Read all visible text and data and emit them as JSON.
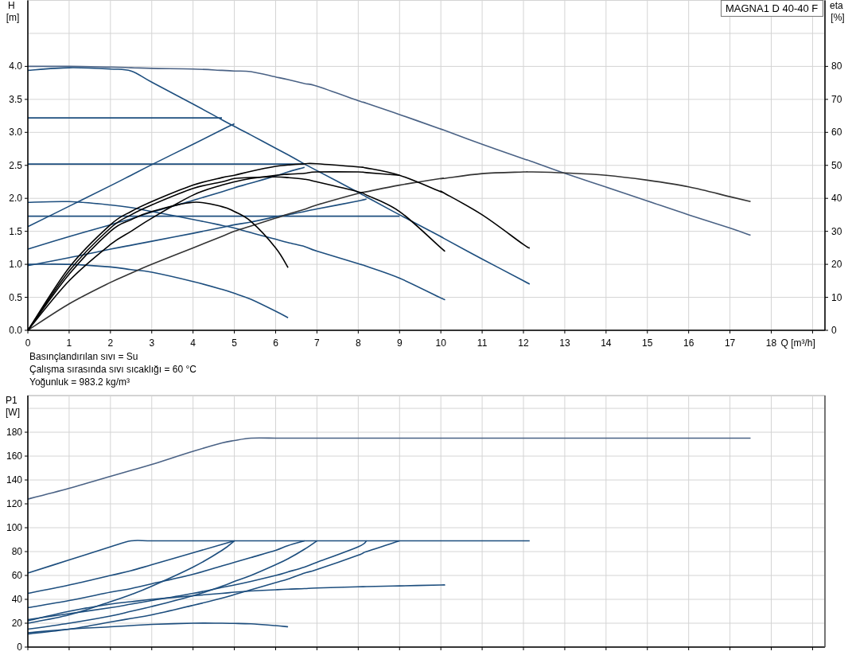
{
  "head_chart": {
    "chart_data": {
      "type": "line",
      "grid": true,
      "title": "MAGNA1 D 40-40 F",
      "xlabel": "Q [m³/h]",
      "ylabel": "H [m]",
      "y2label": "eta [%]",
      "x": [
        0,
        1,
        2,
        2.5,
        3,
        4,
        4.7,
        5,
        5.4,
        6,
        6.3,
        6.7,
        7,
        8,
        8.2,
        9,
        10,
        10.05,
        11,
        12,
        12.15,
        13,
        14,
        15,
        16,
        17,
        17.5
      ],
      "xlim": [
        0,
        19.3
      ],
      "ylim": [
        0,
        5
      ],
      "y2lim": [
        0,
        100
      ],
      "xticks": [
        0,
        1,
        2,
        3,
        4,
        5,
        6,
        7,
        8,
        9,
        10,
        11,
        12,
        13,
        14,
        15,
        16,
        17,
        18
      ],
      "yticks": [
        {
          "value": 0,
          "label": "0.0"
        },
        {
          "value": 0.5,
          "label": "0.5"
        },
        {
          "value": 1,
          "label": "1.0"
        },
        {
          "value": 1.5,
          "label": "1.5"
        },
        {
          "value": 2,
          "label": "2.0"
        },
        {
          "value": 2.5,
          "label": "2.5"
        },
        {
          "value": 3,
          "label": "3.0"
        },
        {
          "value": 3.5,
          "label": "3.5"
        },
        {
          "value": 4,
          "label": "4.0"
        }
      ],
      "y2ticks": [
        0,
        10,
        20,
        30,
        40,
        50,
        60,
        70,
        80
      ],
      "series": [
        {
          "color": "#4a6285",
          "values": [
            4.0,
            4.0,
            3.99,
            3.98,
            3.97,
            3.96,
            3.94,
            3.93,
            3.92,
            3.84,
            3.8,
            3.74,
            3.7,
            3.48,
            3.44,
            3.27,
            3.05,
            3.04,
            2.82,
            2.6,
            2.57,
            2.38,
            2.17,
            1.96,
            1.75,
            1.55,
            1.44
          ]
        },
        {
          "color": "#1d4e7e",
          "values": [
            3.94,
            3.98,
            3.96,
            3.93,
            3.76,
            3.43,
            3.19,
            3.09,
            2.96,
            2.76,
            2.66,
            2.52,
            2.42,
            2.09,
            2.02,
            1.75,
            1.42,
            1.4,
            1.08,
            0.75,
            0.7,
            null,
            null,
            null,
            null,
            null,
            null
          ]
        },
        {
          "color": "#1d4e7e",
          "values": [
            3.22,
            3.22,
            3.22,
            3.22,
            3.22,
            3.22,
            3.22,
            null,
            null,
            null,
            null,
            null,
            null,
            null,
            null,
            null,
            null,
            null,
            null,
            null,
            null,
            null,
            null,
            null,
            null,
            null,
            null
          ]
        },
        {
          "color": "#1d4e7e",
          "values": [
            2.52,
            2.52,
            2.52,
            2.52,
            2.52,
            2.52,
            2.52,
            2.52,
            2.52,
            2.52,
            2.52,
            2.52,
            null,
            null,
            null,
            null,
            null,
            null,
            null,
            null,
            null,
            null,
            null,
            null,
            null,
            null,
            null
          ]
        },
        {
          "color": "#1d4e7e",
          "values": [
            1.73,
            1.73,
            1.73,
            1.73,
            1.73,
            1.73,
            1.73,
            1.73,
            1.73,
            1.73,
            1.73,
            1.73,
            1.73,
            1.73,
            1.73,
            1.73,
            null,
            null,
            null,
            null,
            null,
            null,
            null,
            null,
            null,
            null,
            null
          ]
        },
        {
          "color": "#1d4e7e",
          "values": [
            1.57,
            1.88,
            2.19,
            2.35,
            2.51,
            2.82,
            3.04,
            3.13,
            null,
            null,
            null,
            null,
            null,
            null,
            null,
            null,
            null,
            null,
            null,
            null,
            null,
            null,
            null,
            null,
            null,
            null,
            null
          ]
        },
        {
          "color": "#1d4e7e",
          "values": [
            1.23,
            1.42,
            1.6,
            1.69,
            1.79,
            1.97,
            2.1,
            2.16,
            2.23,
            2.34,
            2.4,
            2.47,
            null,
            null,
            null,
            null,
            null,
            null,
            null,
            null,
            null,
            null,
            null,
            null,
            null,
            null,
            null
          ]
        },
        {
          "color": "#1d4e7e",
          "values": [
            0.98,
            1.1,
            1.23,
            1.29,
            1.35,
            1.47,
            1.56,
            1.6,
            1.64,
            1.72,
            1.75,
            1.8,
            1.84,
            1.96,
            1.99,
            null,
            null,
            null,
            null,
            null,
            null,
            null,
            null,
            null,
            null,
            null,
            null
          ]
        },
        {
          "color": "#1d4e7e",
          "values": [
            1.94,
            1.95,
            1.9,
            1.86,
            1.8,
            1.68,
            1.59,
            1.55,
            1.48,
            1.38,
            1.33,
            1.27,
            1.2,
            1.01,
            0.97,
            0.79,
            0.49,
            0.48,
            null,
            null,
            null,
            null,
            null,
            null,
            null,
            null,
            null
          ]
        },
        {
          "color": "#1d4e7e",
          "values": [
            1.0,
            1.0,
            0.96,
            0.92,
            0.88,
            0.74,
            0.62,
            0.56,
            0.47,
            0.29,
            0.19,
            null,
            null,
            null,
            null,
            null,
            null,
            null,
            null,
            null,
            null,
            null,
            null,
            null,
            null,
            null,
            null
          ]
        },
        {
          "color": "#333333",
          "axis": "y2",
          "values": [
            0,
            8,
            14.5,
            17.3,
            20,
            25,
            28.5,
            30,
            31.6,
            34,
            35.2,
            36.7,
            38,
            41.5,
            42,
            44,
            46,
            46,
            47.5,
            48,
            48,
            47.7,
            47,
            45.5,
            43.5,
            40.5,
            39
          ]
        },
        {
          "color": "#000000",
          "axis": "y2",
          "values": [
            0,
            19,
            32,
            36,
            39,
            44,
            46.3,
            47,
            48.2,
            49.7,
            50.1,
            50.5,
            50.5,
            49.5,
            49.2,
            47,
            42,
            41.8,
            35,
            26,
            25,
            null,
            null,
            null,
            null,
            null,
            null
          ]
        },
        {
          "color": "#000000",
          "axis": "y2",
          "values": [
            0,
            18,
            31,
            35,
            38,
            43,
            45,
            46,
            46.3,
            46.5,
            46.3,
            45.8,
            45,
            42,
            41,
            36,
            25,
            24.5,
            null,
            null,
            null,
            null,
            null,
            null,
            null,
            null,
            null
          ]
        },
        {
          "color": "#000000",
          "axis": "y2",
          "values": [
            0,
            17,
            30,
            33.5,
            36,
            38.8,
            37.5,
            36,
            33,
            25,
            19,
            null,
            null,
            null,
            null,
            null,
            null,
            null,
            null,
            null,
            null,
            null,
            null,
            null,
            null,
            null,
            null
          ]
        },
        {
          "color": "#000000",
          "axis": "y2",
          "values": [
            0,
            15,
            26,
            30,
            34,
            41,
            44,
            45,
            46,
            47,
            47.3,
            47.6,
            48,
            48,
            47.8,
            47,
            null,
            null,
            null,
            null,
            null,
            null,
            null,
            null,
            null,
            null,
            null
          ]
        }
      ]
    }
  },
  "fluid_notes": [
    "Basınçlandırılan sıvı = Su",
    "Çalışma sırasında sıvı sıcaklığı = 60 °C",
    "Yoğunluk = 983.2 kg/m³"
  ],
  "power_chart": {
    "chart_data": {
      "type": "line",
      "grid": true,
      "ylabel": "P1 [W]",
      "x": [
        0,
        1,
        2,
        2.5,
        3,
        4,
        4.7,
        5,
        5.4,
        6,
        6.3,
        6.7,
        7,
        8,
        8.2,
        9,
        10,
        10.05,
        11,
        12,
        12.15,
        13,
        14,
        15,
        16,
        17,
        17.5
      ],
      "xlim": [
        0,
        19.3
      ],
      "ylim": [
        0,
        210.7
      ],
      "yticks": [
        0,
        20,
        40,
        60,
        80,
        100,
        120,
        140,
        160,
        180
      ],
      "series": [
        {
          "color": "#4a6285",
          "values": [
            124,
            133,
            143,
            148,
            153,
            164,
            171,
            173,
            175,
            175,
            175,
            175,
            175,
            175,
            175,
            175,
            175,
            175,
            175,
            175,
            175,
            175,
            175,
            175,
            175,
            175,
            175
          ]
        },
        {
          "color": "#1d4e7e",
          "values": [
            62,
            73,
            84,
            89,
            89,
            89,
            89,
            89,
            89,
            89,
            89,
            89,
            89,
            89,
            89,
            89,
            89,
            89,
            89,
            89,
            89,
            null,
            null,
            null,
            null,
            null,
            null
          ]
        },
        {
          "color": "#1d4e7e",
          "values": [
            45,
            52,
            60,
            64,
            69,
            79,
            86,
            89,
            null,
            null,
            null,
            null,
            null,
            null,
            null,
            null,
            null,
            null,
            null,
            null,
            null,
            null,
            null,
            null,
            null,
            null,
            null
          ]
        },
        {
          "color": "#1d4e7e",
          "values": [
            20,
            27,
            38,
            44,
            51,
            67,
            81,
            89,
            null,
            null,
            null,
            null,
            null,
            null,
            null,
            null,
            null,
            null,
            null,
            null,
            null,
            null,
            null,
            null,
            null,
            null,
            null
          ]
        },
        {
          "color": "#1d4e7e",
          "values": [
            33,
            39,
            46,
            49,
            53,
            61,
            68,
            71,
            75,
            81,
            85,
            89,
            null,
            null,
            null,
            null,
            null,
            null,
            null,
            null,
            null,
            null,
            null,
            null,
            null,
            null,
            null
          ]
        },
        {
          "color": "#1d4e7e",
          "values": [
            15,
            20,
            26,
            30,
            34,
            43,
            51,
            55,
            60,
            69,
            74,
            82,
            89,
            null,
            null,
            null,
            null,
            null,
            null,
            null,
            null,
            null,
            null,
            null,
            null,
            null,
            null
          ]
        },
        {
          "color": "#1d4e7e",
          "values": [
            23,
            28,
            33,
            36,
            39,
            45,
            50,
            52,
            55,
            60,
            63,
            67,
            71,
            84,
            89,
            null,
            null,
            null,
            null,
            null,
            null,
            null,
            null,
            null,
            null,
            null,
            null
          ]
        },
        {
          "color": "#1d4e7e",
          "values": [
            11,
            15,
            21,
            24,
            27,
            35,
            41,
            44,
            48,
            54,
            57,
            62,
            65,
            77,
            80,
            89,
            null,
            null,
            null,
            null,
            null,
            null,
            null,
            null,
            null,
            null,
            null
          ]
        },
        {
          "color": "#1d4e7e",
          "values": [
            22,
            30,
            36,
            38,
            40,
            43,
            45,
            46,
            47,
            48,
            48.5,
            49,
            49.5,
            50.5,
            50.7,
            51.3,
            52,
            52,
            null,
            null,
            null,
            null,
            null,
            null,
            null,
            null,
            null
          ]
        },
        {
          "color": "#1d4e7e",
          "values": [
            12,
            15,
            17,
            18,
            19,
            20,
            20,
            19.8,
            19.5,
            18,
            17,
            null,
            null,
            null,
            null,
            null,
            null,
            null,
            null,
            null,
            null,
            null,
            null,
            null,
            null,
            null,
            null
          ]
        }
      ]
    }
  }
}
